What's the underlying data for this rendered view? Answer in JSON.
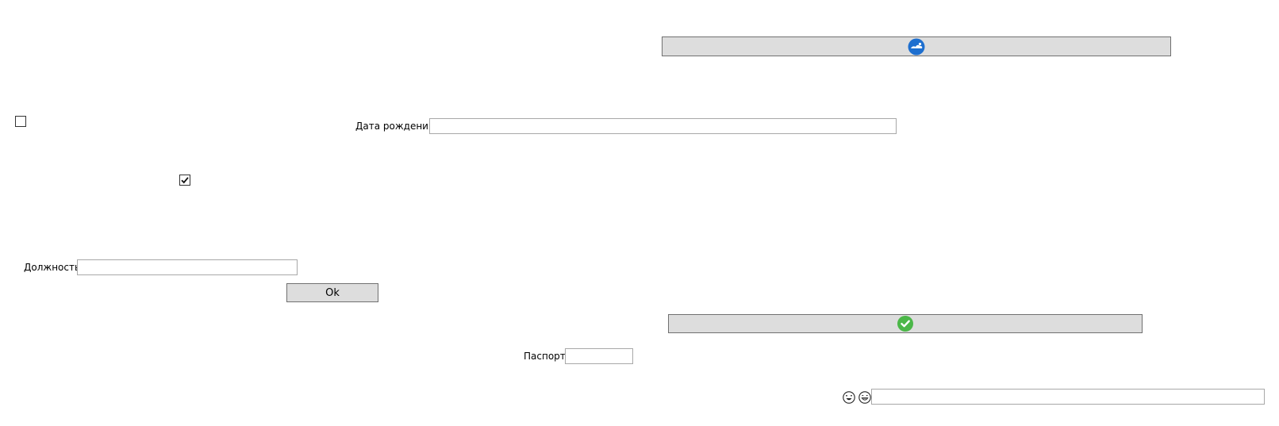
{
  "top_button": {
    "icon": "blue-cloud-logo-icon"
  },
  "checkboxes": [
    {
      "checked": false
    },
    {
      "checked": true
    }
  ],
  "birth_date": {
    "label": "Дата рождения",
    "value": ""
  },
  "position": {
    "label": "Должность",
    "value": ""
  },
  "ok_button": {
    "label": "Ok"
  },
  "confirm_button": {
    "icon": "green-check-icon"
  },
  "passport": {
    "label": "Паспорт",
    "value": ""
  },
  "emoji_field": {
    "icons": [
      "laughing-face-icon",
      "grinning-face-icon"
    ],
    "value": ""
  },
  "colors": {
    "button_bg": "#dddddd",
    "button_border": "#707070",
    "input_border": "#a8a8a8",
    "accent_blue": "#1e6fcf",
    "accent_green": "#4bb748"
  }
}
